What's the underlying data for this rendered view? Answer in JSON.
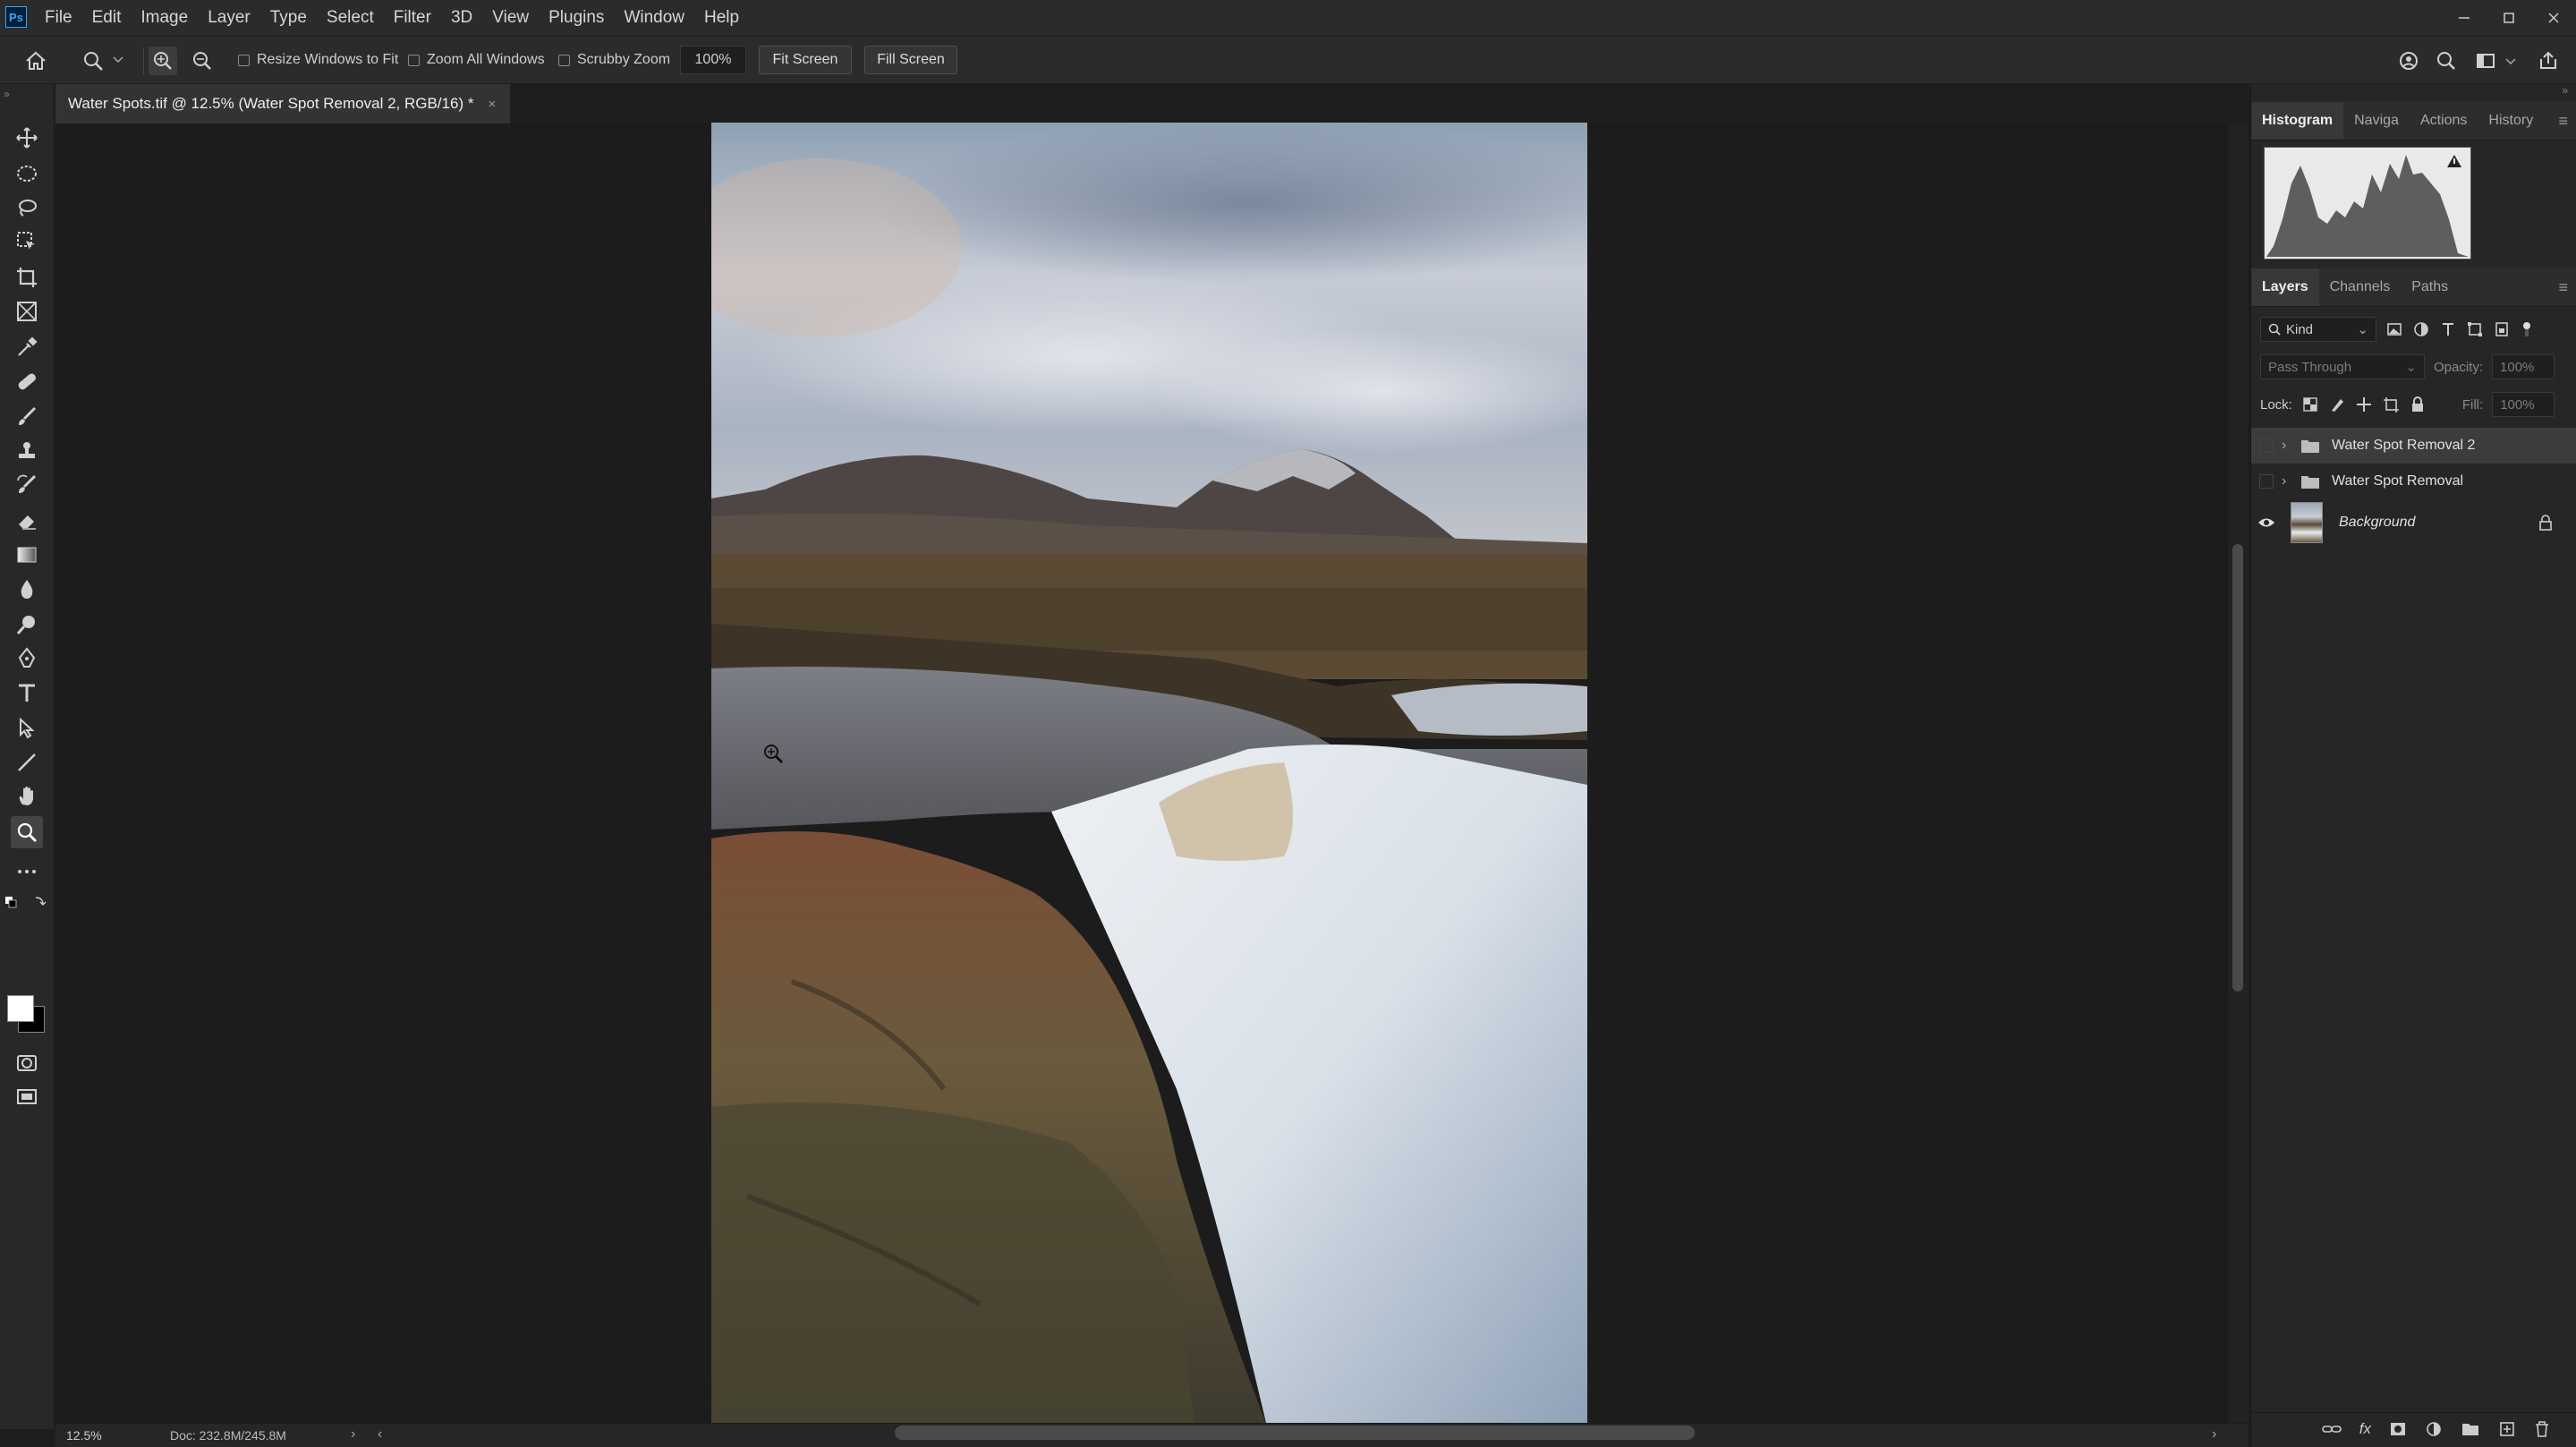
{
  "app": {
    "logo": "Ps"
  },
  "menubar": {
    "items": [
      "File",
      "Edit",
      "Image",
      "Layer",
      "Type",
      "Select",
      "Filter",
      "3D",
      "View",
      "Plugins",
      "Window",
      "Help"
    ]
  },
  "options": {
    "resize_windows": "Resize Windows to Fit",
    "zoom_all": "Zoom All Windows",
    "scrubby_zoom": "Scrubby Zoom",
    "zoom_value": "100%",
    "fit_screen": "Fit Screen",
    "fill_screen": "Fill Screen"
  },
  "document": {
    "tab_title": "Water Spots.tif @ 12.5% (Water Spot Removal 2, RGB/16) *",
    "close": "×"
  },
  "status": {
    "zoom": "12.5%",
    "doc_size": "Doc: 232.8M/245.8M",
    "next_arrow": "›",
    "prev_arrow": "‹"
  },
  "panels": {
    "top_tabs": [
      "Histogram",
      "Naviga",
      "Actions",
      "History"
    ],
    "layer_tabs": [
      "Layers",
      "Channels",
      "Paths"
    ],
    "kind_filter": "Kind",
    "blend_mode": "Pass Through",
    "opacity_label": "Opacity:",
    "opacity_value": "100%",
    "lock_label": "Lock:",
    "fill_label": "Fill:",
    "fill_value": "100%"
  },
  "layers": [
    {
      "name": "Water Spot Removal 2",
      "type": "group",
      "selected": true,
      "visible": false
    },
    {
      "name": "Water Spot Removal",
      "type": "group",
      "selected": false,
      "visible": false
    },
    {
      "name": "Background",
      "type": "image",
      "selected": false,
      "visible": true,
      "locked": true
    }
  ],
  "colors": {
    "accent": "#31a8ff",
    "ui_bg": "#2b2b2b",
    "canvas_bg": "#1c1c1c"
  }
}
